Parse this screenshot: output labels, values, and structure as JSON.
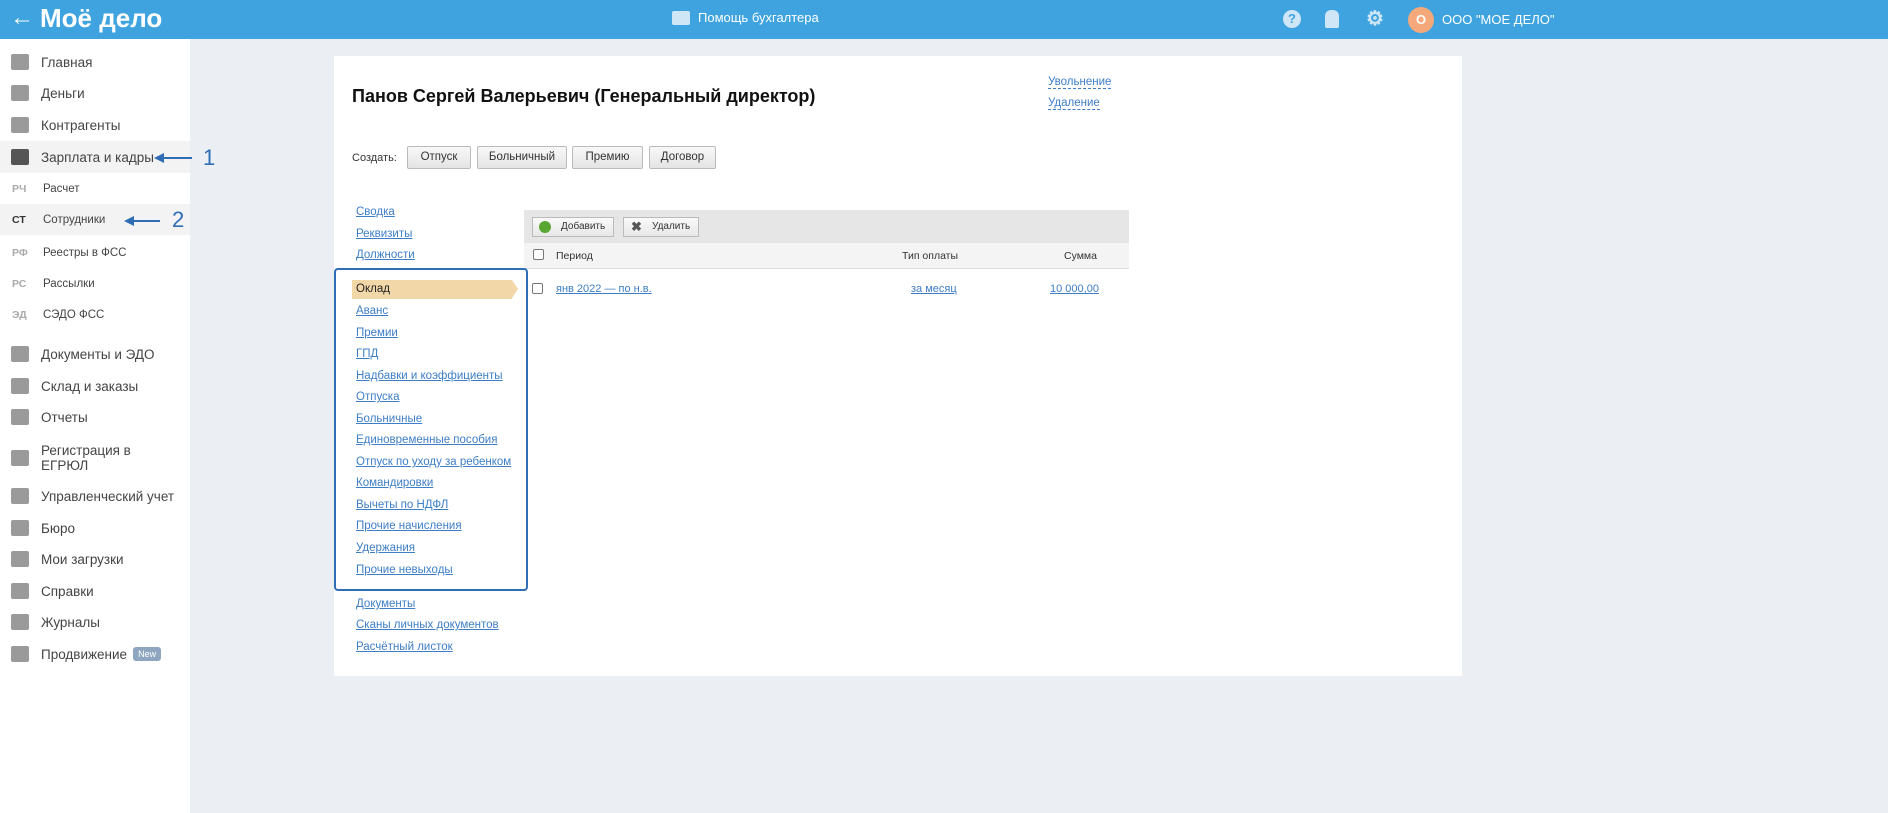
{
  "header": {
    "logo": "Моё дело",
    "help": "Помощь бухгалтера",
    "avatar_letter": "О",
    "org": "ООО \"МОЕ ДЕЛО\""
  },
  "sidebar": {
    "items": [
      {
        "label": "Главная"
      },
      {
        "label": "Деньги"
      },
      {
        "label": "Контрагенты"
      },
      {
        "label": "Зарплата и кадры"
      }
    ],
    "sub": [
      {
        "ab": "РЧ",
        "label": "Расчет"
      },
      {
        "ab": "СТ",
        "label": "Сотрудники"
      },
      {
        "ab": "РФ",
        "label": "Реестры в ФСС"
      },
      {
        "ab": "РС",
        "label": "Рассылки"
      },
      {
        "ab": "ЭД",
        "label": "СЭДО ФСС"
      }
    ],
    "items2": [
      {
        "label": "Документы и ЭДО"
      },
      {
        "label": "Склад и заказы"
      },
      {
        "label": "Отчеты"
      },
      {
        "label": "Регистрация в ЕГРЮЛ"
      },
      {
        "label": "Управленческий учет"
      },
      {
        "label": "Бюро"
      },
      {
        "label": "Мои загрузки"
      },
      {
        "label": "Справки"
      },
      {
        "label": "Журналы"
      },
      {
        "label": "Продвижение"
      }
    ],
    "new_badge": "New"
  },
  "main": {
    "title": "Панов Сергей Валерьевич (Генеральный директор)",
    "dismiss": "Увольнение",
    "delete": "Удаление",
    "create_label": "Создать:",
    "create_buttons": [
      "Отпуск",
      "Больничный",
      "Премию",
      "Договор"
    ],
    "nav_top": [
      "Сводка",
      "Реквизиты",
      "Должности"
    ],
    "active": "Оклад",
    "nav_mid": [
      "Аванс",
      "Премии",
      "ГПД",
      "Надбавки и коэффициенты",
      "Отпуска",
      "Больничные",
      "Единовременные пособия",
      "Отпуск по уходу за ребенком",
      "Командировки",
      "Вычеты по НДФЛ",
      "Прочие начисления",
      "Удержания",
      "Прочие невыходы"
    ],
    "nav_bottom": [
      "Документы",
      "Сканы личных документов",
      "Расчётный листок"
    ],
    "toolbar": {
      "add": "Добавить",
      "remove": "Удалить"
    },
    "table": {
      "headers": [
        "Период",
        "Тип оплаты",
        "Сумма"
      ],
      "rows": [
        {
          "period": "янв 2022 — по н.в.",
          "type": "за месяц",
          "sum": "10 000,00"
        }
      ]
    }
  },
  "annotations": [
    "1",
    "2"
  ]
}
